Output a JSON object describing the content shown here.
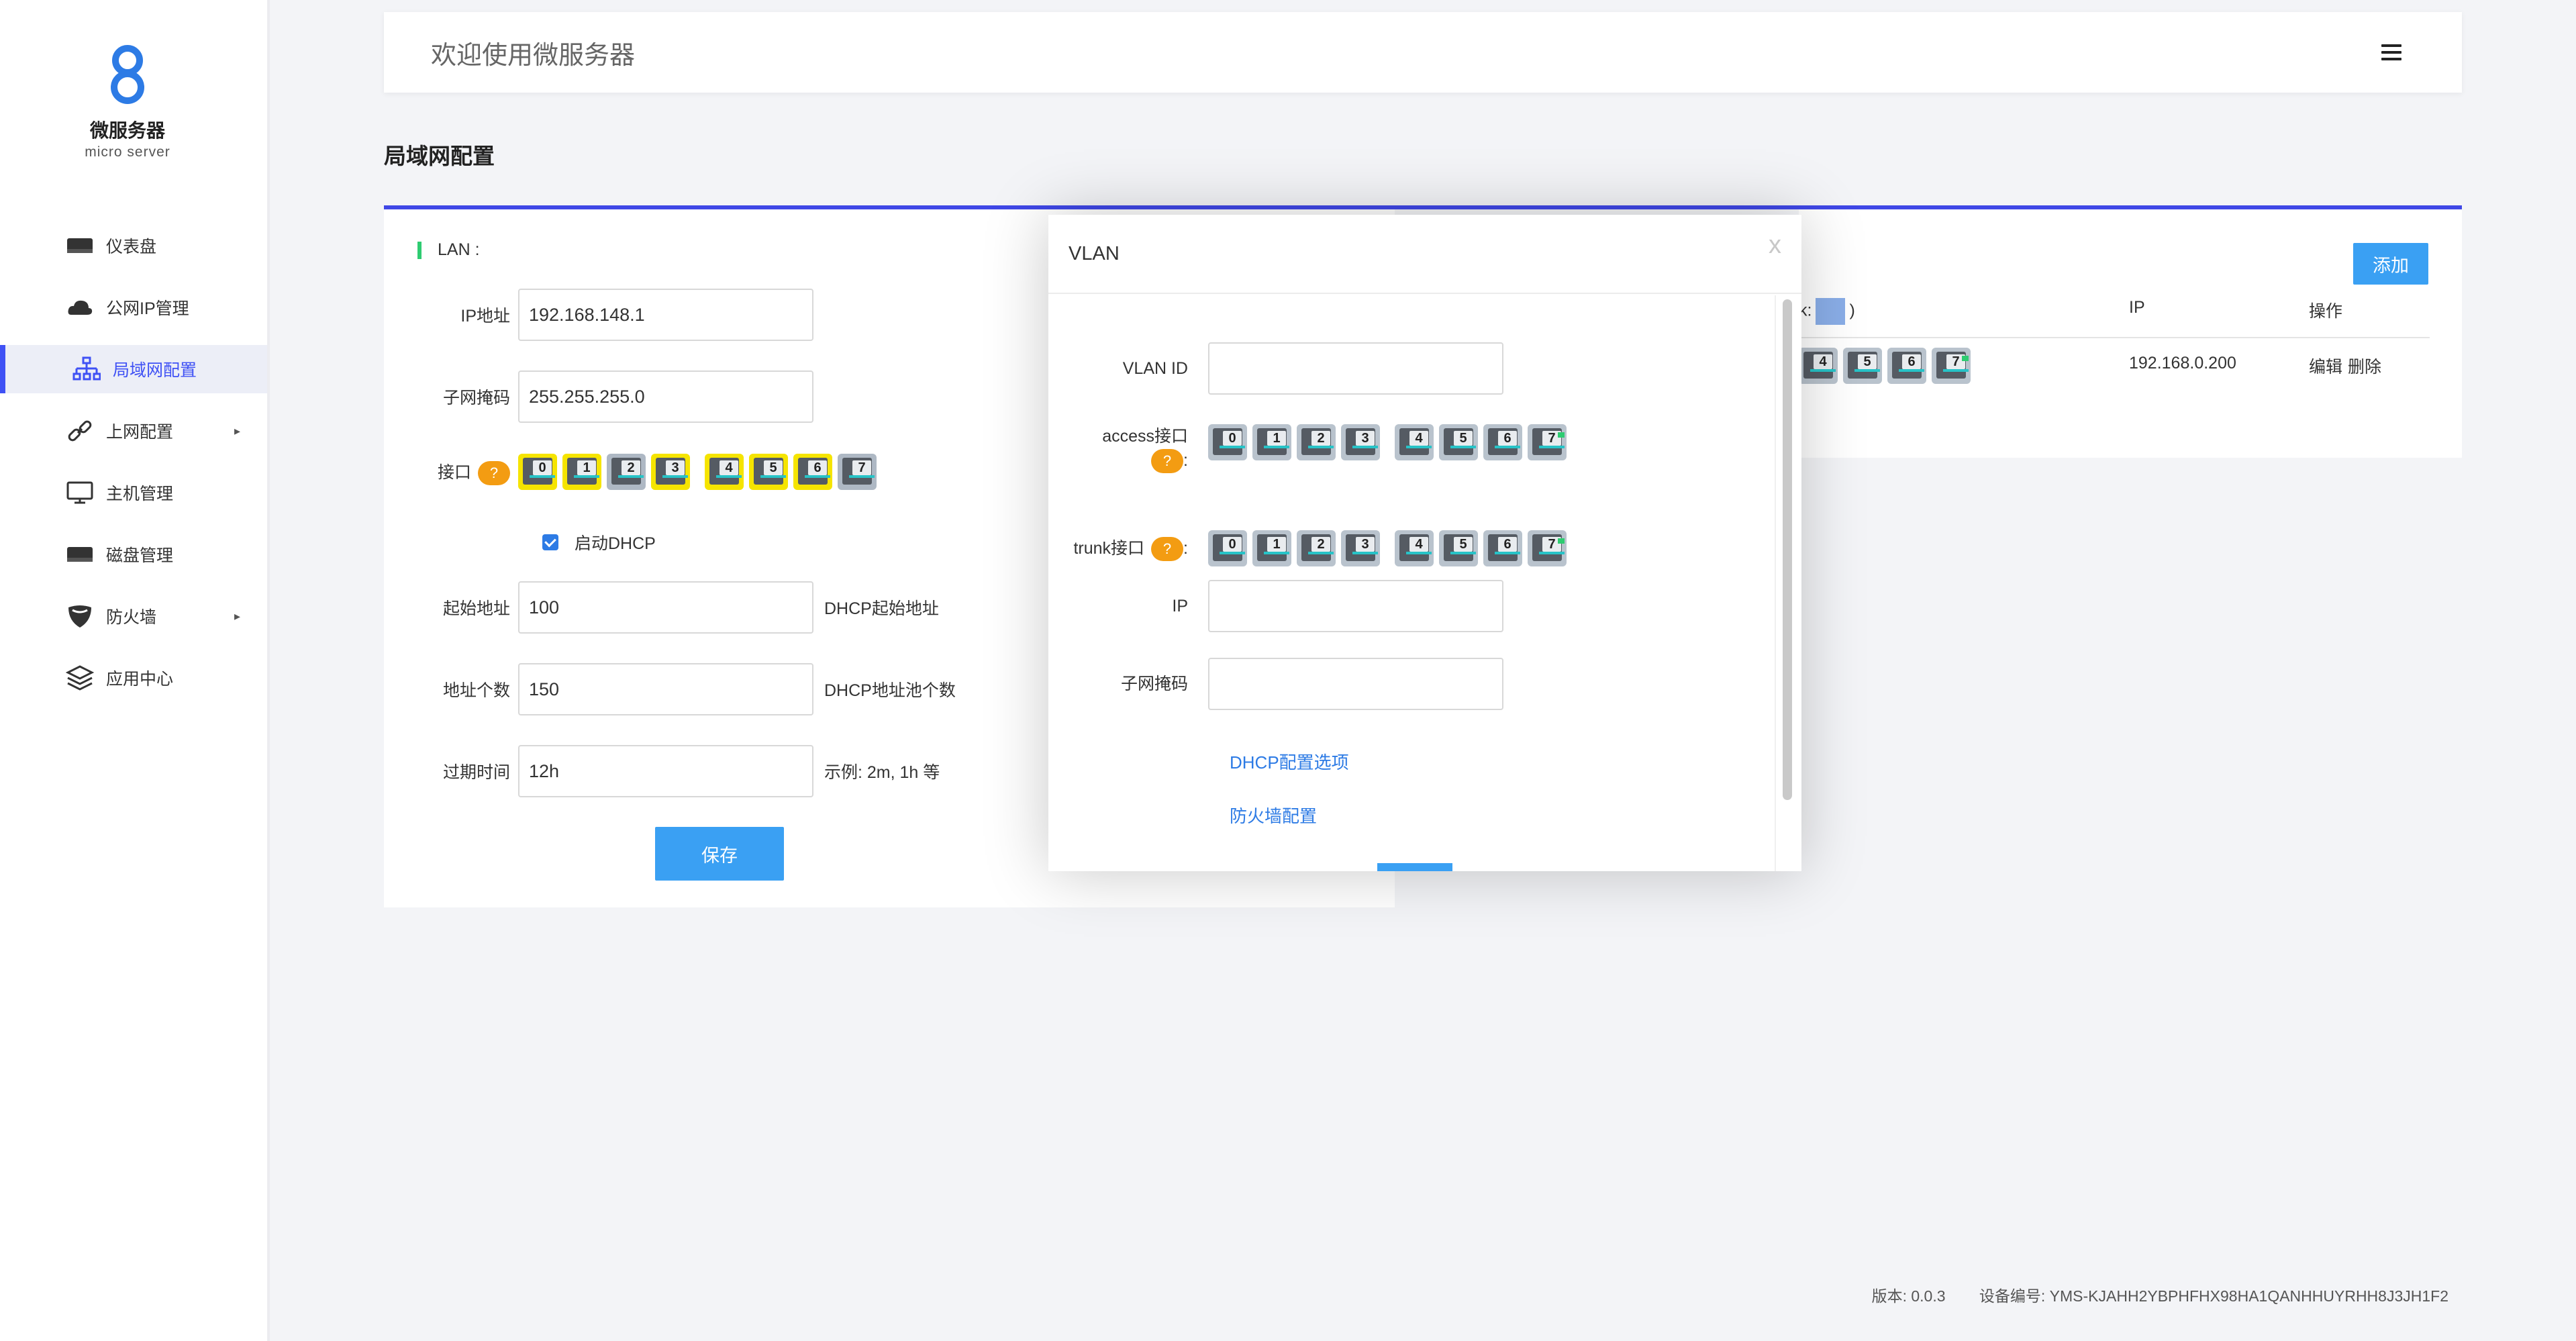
{
  "app": {
    "logo_name": "微服务器",
    "logo_sub": "micro server",
    "header_title": "欢迎使用微服务器"
  },
  "sidebar": {
    "items": [
      {
        "label": "仪表盘",
        "icon": "dashboard-icon"
      },
      {
        "label": "公网IP管理",
        "icon": "cloud-icon"
      },
      {
        "label": "局域网配置",
        "icon": "network-tree-icon",
        "active": true
      },
      {
        "label": "上网配置",
        "icon": "link-icon",
        "has_submenu": true
      },
      {
        "label": "主机管理",
        "icon": "monitor-icon"
      },
      {
        "label": "磁盘管理",
        "icon": "disk-icon"
      },
      {
        "label": "防火墙",
        "icon": "shield-icon",
        "has_submenu": true
      },
      {
        "label": "应用中心",
        "icon": "layers-icon"
      }
    ],
    "arrow": "▸"
  },
  "page": {
    "title": "局域网配置"
  },
  "lan": {
    "heading": "LAN :",
    "ip_label": "IP地址",
    "ip_value": "192.168.148.1",
    "mask_label": "子网掩码",
    "mask_value": "255.255.255.0",
    "port_label": "接口",
    "help": "?",
    "ports": [
      {
        "num": "0",
        "state": "yellow"
      },
      {
        "num": "1",
        "state": "yellow"
      },
      {
        "num": "2",
        "state": "grey"
      },
      {
        "num": "3",
        "state": "yellow"
      },
      {
        "num": "4",
        "state": "yellow"
      },
      {
        "num": "5",
        "state": "yellow"
      },
      {
        "num": "6",
        "state": "yellow"
      },
      {
        "num": "7",
        "state": "grey"
      }
    ],
    "dhcp_label": "启动DHCP",
    "dhcp_enabled": true,
    "start_label": "起始地址",
    "start_value": "100",
    "start_hint": "DHCP起始地址",
    "count_label": "地址个数",
    "count_value": "150",
    "count_hint": "DHCP地址池个数",
    "lease_label": "过期时间",
    "lease_value": "12h",
    "lease_hint": "示例: 2m, 1h 等",
    "save_label": "保存"
  },
  "vlan_list": {
    "add_label": "添加",
    "col_ports_prefix": "k:",
    "col_ports_suffix": ")",
    "col_ip": "IP",
    "col_ops": "操作",
    "row": {
      "ports": [
        "4",
        "5",
        "6",
        "7"
      ],
      "ip": "192.168.0.200",
      "edit": "编辑",
      "delete": "删除"
    }
  },
  "modal": {
    "title": "VLAN",
    "close": "x",
    "vlan_id_label": "VLAN ID",
    "vlan_id_value": "",
    "access_label": "access接口",
    "trunk_label": "trunk接口",
    "colon": ":",
    "help": "?",
    "access_ports": [
      "0",
      "1",
      "2",
      "3",
      "4",
      "5",
      "6",
      "7"
    ],
    "trunk_ports": [
      "0",
      "1",
      "2",
      "3",
      "4",
      "5",
      "6",
      "7"
    ],
    "ip_label": "IP",
    "ip_value": "",
    "mask_label": "子网掩码",
    "mask_value": "",
    "dhcp_link": "DHCP配置选项",
    "firewall_link": "防火墙配置"
  },
  "footer": {
    "version": "版本: 0.0.3",
    "device_id": "设备编号: YMS-KJAHH2YBPHFHX98HA1QANHHUYRHH8J3JH1F2"
  },
  "colors": {
    "accent": "#3f47e6",
    "button": "#3aa0f3",
    "port_active": "#f5e400",
    "help": "#f39c12"
  }
}
